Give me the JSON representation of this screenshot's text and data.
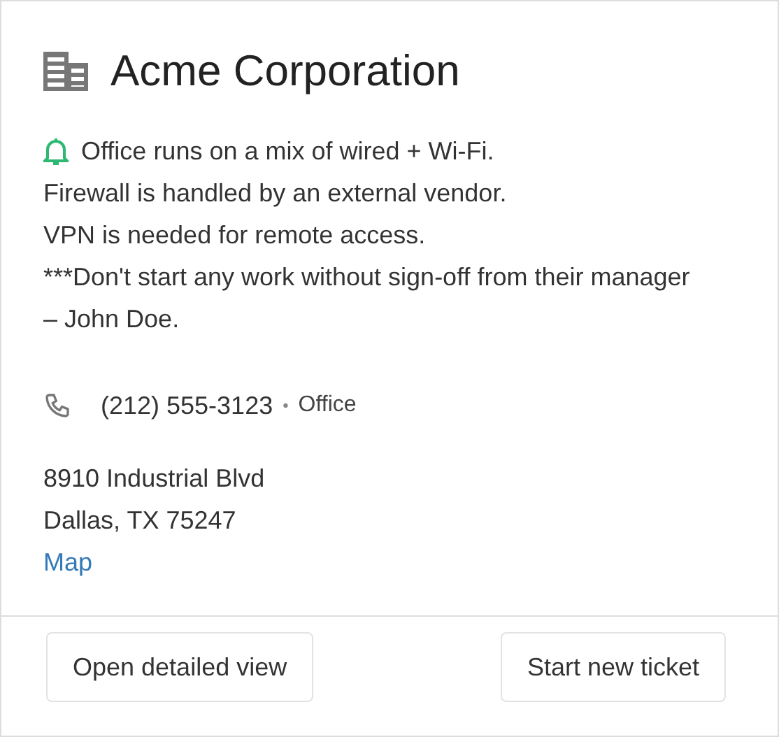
{
  "title": "Acme Corporation",
  "notes": [
    "Office runs on a mix of wired + Wi-Fi.",
    "Firewall is handled by an external vendor.",
    "VPN is needed for remote access.",
    "***Don't start any work without sign-off from their manager – John Doe."
  ],
  "phone": {
    "number": "(212) 555-3123",
    "separator": "•",
    "type": "Office"
  },
  "address": [
    "8910 Industrial Blvd",
    "Dallas, TX 75247"
  ],
  "map_link": "Map",
  "buttons": [
    "Open detailed view",
    "Start new ticket"
  ]
}
